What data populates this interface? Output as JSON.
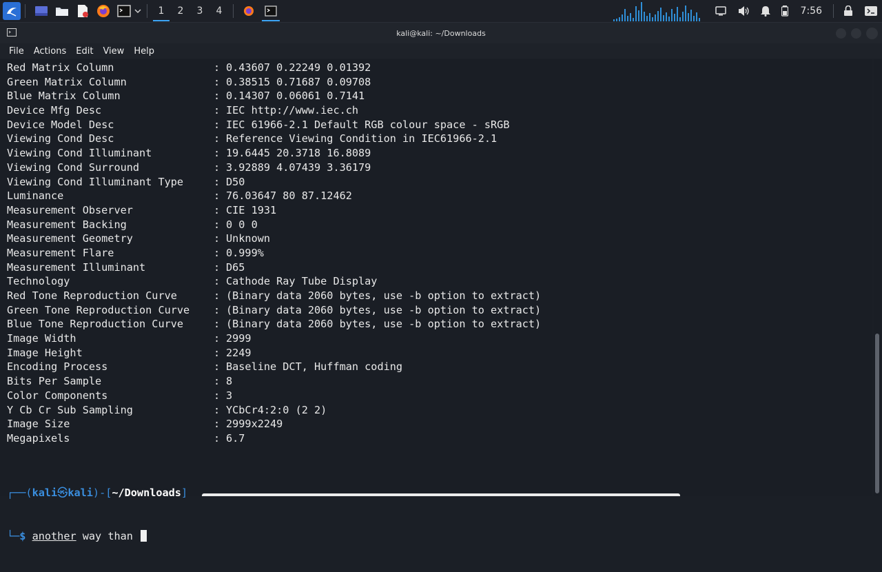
{
  "taskbar": {
    "workspaces": [
      "1",
      "2",
      "3",
      "4"
    ],
    "active_workspace": "1",
    "clock": "7:56",
    "accent": "#3da5f5"
  },
  "window": {
    "title": "kali@kali: ~/Downloads"
  },
  "menu": {
    "items": [
      "File",
      "Actions",
      "Edit",
      "View",
      "Help"
    ]
  },
  "terminal": {
    "rows": [
      {
        "tag": "Red Matrix Column",
        "value": "0.43607 0.22249 0.01392"
      },
      {
        "tag": "Green Matrix Column",
        "value": "0.38515 0.71687 0.09708"
      },
      {
        "tag": "Blue Matrix Column",
        "value": "0.14307 0.06061 0.7141"
      },
      {
        "tag": "Device Mfg Desc",
        "value": "IEC http://www.iec.ch"
      },
      {
        "tag": "Device Model Desc",
        "value": "IEC 61966-2.1 Default RGB colour space - sRGB"
      },
      {
        "tag": "Viewing Cond Desc",
        "value": "Reference Viewing Condition in IEC61966-2.1"
      },
      {
        "tag": "Viewing Cond Illuminant",
        "value": "19.6445 20.3718 16.8089"
      },
      {
        "tag": "Viewing Cond Surround",
        "value": "3.92889 4.07439 3.36179"
      },
      {
        "tag": "Viewing Cond Illuminant Type",
        "value": "D50"
      },
      {
        "tag": "Luminance",
        "value": "76.03647 80 87.12462"
      },
      {
        "tag": "Measurement Observer",
        "value": "CIE 1931"
      },
      {
        "tag": "Measurement Backing",
        "value": "0 0 0"
      },
      {
        "tag": "Measurement Geometry",
        "value": "Unknown"
      },
      {
        "tag": "Measurement Flare",
        "value": "0.999%"
      },
      {
        "tag": "Measurement Illuminant",
        "value": "D65"
      },
      {
        "tag": "Technology",
        "value": "Cathode Ray Tube Display"
      },
      {
        "tag": "Red Tone Reproduction Curve",
        "value": "(Binary data 2060 bytes, use -b option to extract)"
      },
      {
        "tag": "Green Tone Reproduction Curve",
        "value": "(Binary data 2060 bytes, use -b option to extract)"
      },
      {
        "tag": "Blue Tone Reproduction Curve",
        "value": "(Binary data 2060 bytes, use -b option to extract)"
      },
      {
        "tag": "Image Width",
        "value": "2999"
      },
      {
        "tag": "Image Height",
        "value": "2249"
      },
      {
        "tag": "Encoding Process",
        "value": "Baseline DCT, Huffman coding"
      },
      {
        "tag": "Bits Per Sample",
        "value": "8"
      },
      {
        "tag": "Color Components",
        "value": "3"
      },
      {
        "tag": "Y Cb Cr Sub Sampling",
        "value": "YCbCr4:2:0 (2 2)"
      },
      {
        "tag": "Image Size",
        "value": "2999x2249"
      },
      {
        "tag": "Megapixels",
        "value": "6.7"
      }
    ],
    "separator": ":",
    "prompt": {
      "box_open": "┌──(",
      "user": "kali",
      "at": "㉿",
      "host": "kali",
      "mid": ")-[",
      "path": "~/Downloads",
      "close": "]",
      "line2": "└─",
      "dollar": "$",
      "cmd_first": "another",
      "cmd_rest": " way than "
    }
  }
}
